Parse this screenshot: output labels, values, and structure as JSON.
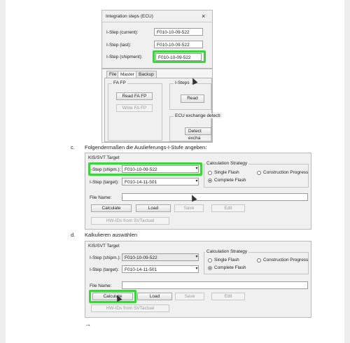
{
  "top_window": {
    "title": "Integration steps (ECU)",
    "close_glyph": "×",
    "rows": [
      {
        "label": "I-Step (current):",
        "value": "F010-10-09-522"
      },
      {
        "label": "I-Step (last):",
        "value": "F010-10-09-522"
      },
      {
        "label": "I-Step (shipment):",
        "value": "F010-10-09-522"
      }
    ],
    "tabs": [
      "File",
      "Master",
      "Backup"
    ],
    "fa_group": "FA FP",
    "read_fa_fp": "Read FA FP",
    "write_fa_fp": "Write FA FP",
    "isteps_group": "I-Steps",
    "read": "Read",
    "ecu_group": "ECU exchange detecti",
    "detect": "Detect excha"
  },
  "step_c": {
    "letter": "c.",
    "text": "Folgendermaßen die Auslieferungs-I-Stufe angeben:",
    "panel": {
      "group_title": "KIS/SVT Target",
      "shipm_label": "I-Step (shipm.):",
      "shipm_value": "F010-10-09-522",
      "target_label": "I-Step (target):",
      "target_value": "F010-14-11-501",
      "strategy_title": "Calculation Strategy",
      "opt_single": "Single Flash",
      "opt_construction": "Construction Progress",
      "opt_complete": "Complete Flash",
      "file_label": "File Name:",
      "calculate": "Calculate",
      "load": "Load",
      "save": "Save",
      "edit": "Edit",
      "hw_ids": "HW-IDs from SVTactual"
    }
  },
  "step_d": {
    "letter": "d.",
    "text": "Kalkulieren auswählen",
    "panel": {
      "group_title": "KIS/SVT Target",
      "shipm_label": "I-Step (shipm.):",
      "shipm_value": "F010-10-09-522",
      "target_label": "I-Step (target):",
      "target_value": "F010-14-11-501",
      "strategy_title": "Calculation Strategy",
      "opt_single": "Single Flash",
      "opt_construction": "Construction Progress",
      "opt_complete": "Complete Flash",
      "file_label": "File Name:",
      "calculate": "Calculate",
      "load": "Load",
      "save": "Save",
      "edit": "Edit",
      "hw_ids": "HW-IDs from SVTactual"
    }
  },
  "arrow": "→",
  "colors": {
    "highlight": "#3fd13f",
    "window_bg": "#f0f0f0"
  }
}
